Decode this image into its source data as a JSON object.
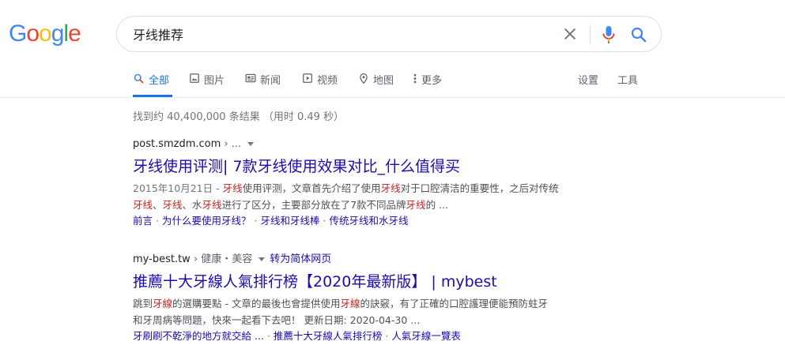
{
  "logo": {
    "letters": [
      {
        "ch": "G",
        "color": "#4285f4"
      },
      {
        "ch": "o",
        "color": "#ea4335"
      },
      {
        "ch": "o",
        "color": "#fbbc05"
      },
      {
        "ch": "g",
        "color": "#4285f4"
      },
      {
        "ch": "l",
        "color": "#34a853"
      },
      {
        "ch": "e",
        "color": "#ea4335"
      }
    ]
  },
  "search": {
    "query": "牙线推荐"
  },
  "tabs": {
    "all": "全部",
    "images": "图片",
    "news": "新闻",
    "videos": "视频",
    "maps": "地图",
    "more": "更多",
    "settings": "设置",
    "tools": "工具"
  },
  "stats": "找到约 40,400,000 条结果 （用时 0.49 秒）",
  "results": [
    {
      "domain": "post.smzdm.com",
      "crumb": "› ...",
      "title": "牙线使用评测| 7款牙线使用效果对比_什么值得买",
      "snippet_line1": [
        {
          "t": "2015年10月21日 - ",
          "c": "date"
        },
        {
          "t": "牙线",
          "c": "hl"
        },
        {
          "t": "使用评测，文章首先介绍了使用",
          "c": ""
        },
        {
          "t": "牙线",
          "c": "hl"
        },
        {
          "t": "对于口腔清洁的重要性，之后对传统",
          "c": ""
        }
      ],
      "snippet_line2": [
        {
          "t": "牙线",
          "c": "hl"
        },
        {
          "t": "、",
          "c": ""
        },
        {
          "t": "牙线",
          "c": "hl"
        },
        {
          "t": "、水",
          "c": ""
        },
        {
          "t": "牙线",
          "c": "hl"
        },
        {
          "t": "进行了区分，主要部分放在了7款不同品牌",
          "c": ""
        },
        {
          "t": "牙线",
          "c": "hl"
        },
        {
          "t": "的 ...",
          "c": ""
        }
      ],
      "sitelinks": [
        "前言",
        "为什么要使用牙线？",
        "牙线和牙线棒",
        "传统牙线和水牙线"
      ]
    },
    {
      "domain": "my-best.tw",
      "crumb": "› 健康・美容",
      "translate": "转为简体网页",
      "title": "推薦十大牙線人氣排行榜【2020年最新版】 | mybest",
      "snippet_line1": [
        {
          "t": "跳到",
          "c": ""
        },
        {
          "t": "牙線",
          "c": "hl"
        },
        {
          "t": "的選購要點 - 文章的最後也會提供使用",
          "c": ""
        },
        {
          "t": "牙線",
          "c": "hl"
        },
        {
          "t": "的訣竅，有了正確的口腔護理便能預防蛀牙",
          "c": ""
        }
      ],
      "snippet_line2": [
        {
          "t": "和牙周病等問題，快來一起看下去吧！ 更新日期: 2020-04-30 ...",
          "c": ""
        }
      ],
      "sitelinks": [
        "牙刷刷不乾淨的地方就交給 ...",
        "推薦十大牙線人氣排行榜",
        "人氣牙線一覽表"
      ]
    }
  ]
}
